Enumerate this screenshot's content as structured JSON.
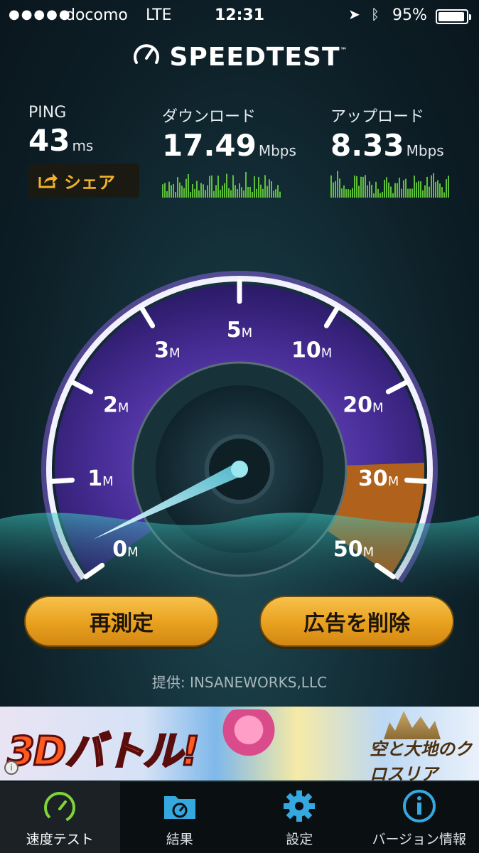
{
  "status": {
    "signal_dots": "●●●●●",
    "carrier": "docomo",
    "network": "LTE",
    "time": "12:31",
    "battery": "95%"
  },
  "logo": {
    "text": "SPEEDTEST",
    "tm": "™"
  },
  "stats": {
    "ping": {
      "label": "PING",
      "value": "43",
      "unit": "ms"
    },
    "download": {
      "label": "ダウンロード",
      "value": "17.49",
      "unit": "Mbps"
    },
    "upload": {
      "label": "アップロード",
      "value": "8.33",
      "unit": "Mbps"
    }
  },
  "share_label": "シェア",
  "gauge": {
    "ticks": [
      "0",
      "1",
      "2",
      "3",
      "5",
      "10",
      "20",
      "30",
      "50"
    ],
    "tick_unit": "M",
    "needle_value": 0.3
  },
  "buttons": {
    "retest": "再測定",
    "remove_ads": "広告を削除"
  },
  "provider": "提供: INSANEWORKS,LLC",
  "ad": {
    "headline": "3Dバトル!",
    "game_title": "空と大地のクロスリア",
    "info_icon": "i"
  },
  "tabs": [
    {
      "label": "速度テスト",
      "icon": "speedometer-icon",
      "active": true
    },
    {
      "label": "結果",
      "icon": "folder-gauge-icon",
      "active": false
    },
    {
      "label": "設定",
      "icon": "gear-icon",
      "active": false
    },
    {
      "label": "バージョン情報",
      "icon": "info-icon",
      "active": false
    }
  ],
  "colors": {
    "accent": "#f3b12a",
    "button": "#eba522",
    "gauge_purple": "#5b3aa8",
    "gauge_orange": "#c66a1e",
    "needle": "#9be7f0",
    "tab_green": "#7fd43a",
    "tab_blue": "#35a8e0"
  }
}
